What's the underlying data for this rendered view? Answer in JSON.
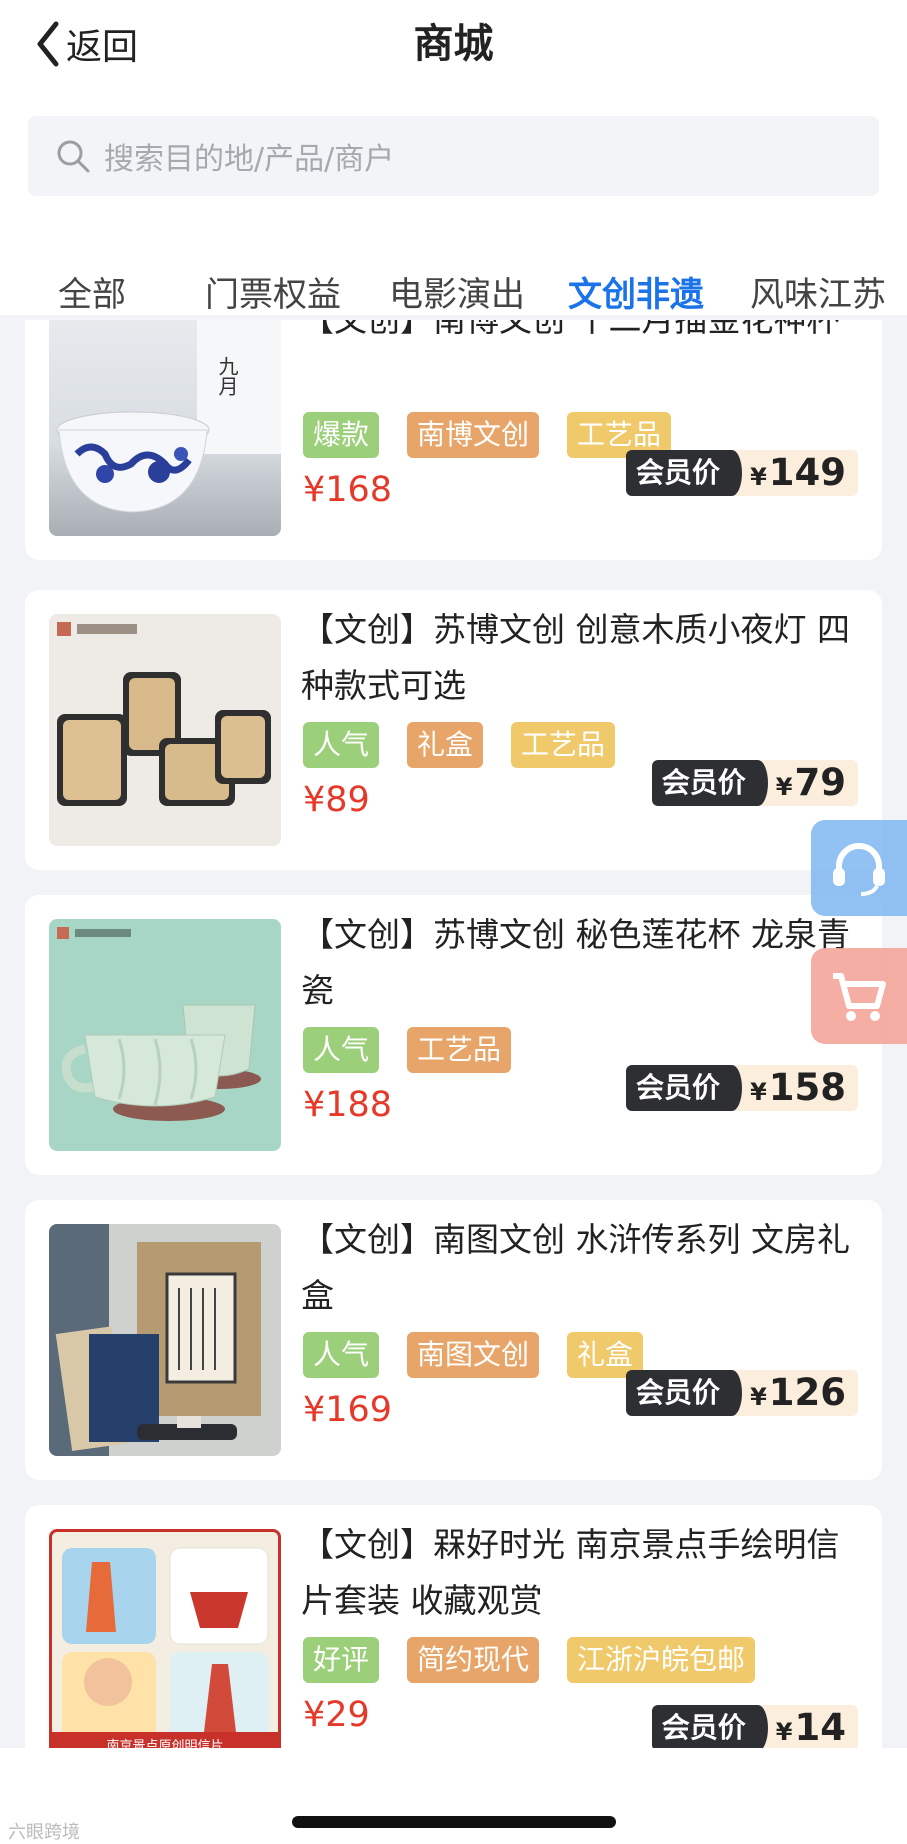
{
  "header": {
    "back_label": "返回",
    "title": "商城"
  },
  "search": {
    "placeholder": "搜索目的地/产品/商户"
  },
  "tabs": [
    "全部",
    "门票权益",
    "电影演出",
    "文创非遗",
    "风味江苏"
  ],
  "active_tab": "文创非遗",
  "colors": {
    "accent": "#1a73e8",
    "price": "#e53a2a",
    "tag_green": "#9ccf7a",
    "tag_orange": "#e8a569",
    "tag_yellow": "#f0c96a"
  },
  "products": [
    {
      "name": "【文创】南博文创 十二月描金花神杯",
      "tags": [
        "爆款",
        "南博文创",
        "工艺品"
      ],
      "price": "¥168",
      "member_label": "会员价",
      "member_currency": "¥",
      "member_price": "149"
    },
    {
      "name": "【文创】苏博文创 创意木质小夜灯 四种款式可选",
      "tags": [
        "人气",
        "礼盒",
        "工艺品"
      ],
      "price": "¥89",
      "member_label": "会员价",
      "member_currency": "¥",
      "member_price": "79"
    },
    {
      "name": "【文创】苏博文创 秘色莲花杯 龙泉青瓷",
      "tags": [
        "人气",
        "工艺品"
      ],
      "price": "¥188",
      "member_label": "会员价",
      "member_currency": "¥",
      "member_price": "158"
    },
    {
      "name": "【文创】南图文创 水浒传系列 文房礼盒",
      "tags": [
        "人气",
        "南图文创",
        "礼盒"
      ],
      "price": "¥169",
      "member_label": "会员价",
      "member_currency": "¥",
      "member_price": "126"
    },
    {
      "name": "【文创】槑好时光 南京景点手绘明信片套装 收藏观赏",
      "tags": [
        "好评",
        "简约现代",
        "江浙沪皖包邮"
      ],
      "price": "¥29",
      "member_label": "会员价",
      "member_currency": "¥",
      "member_price": "14"
    }
  ],
  "thumb_texts": {
    "p1": "九月",
    "p5_banner": "南京景点原创明信片"
  },
  "watermark": "六眼跨境",
  "floating": {
    "service_icon": "headset-icon",
    "cart_icon": "cart-icon"
  }
}
